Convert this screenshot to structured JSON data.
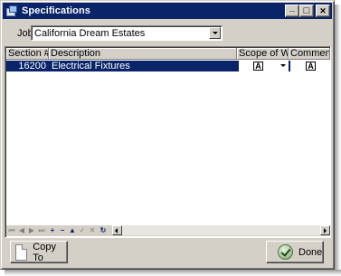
{
  "window": {
    "title": "Specifications",
    "controls": {
      "minimize": "_",
      "maximize": "□",
      "close": "✕"
    }
  },
  "job": {
    "label": "Job:",
    "value": "California Dream Estates"
  },
  "grid": {
    "columns": [
      "Section #",
      "Description",
      "Scope of Work",
      "Comments"
    ],
    "rows": [
      {
        "section": "16200",
        "description": "Electrical Fixtures",
        "scope_icon": "A",
        "comments_icon": "A",
        "selected": true
      }
    ]
  },
  "navbar": {
    "buttons": [
      "⏮",
      "◀",
      "▶",
      "⏭",
      "+",
      "−",
      "▲",
      "✓",
      "✕",
      "↻"
    ]
  },
  "buttons": {
    "copy_to": "Copy To",
    "done": "Done"
  },
  "colors": {
    "titlebar": "#0a246a",
    "selection": "#0a246a",
    "face": "#d4d0c8"
  }
}
